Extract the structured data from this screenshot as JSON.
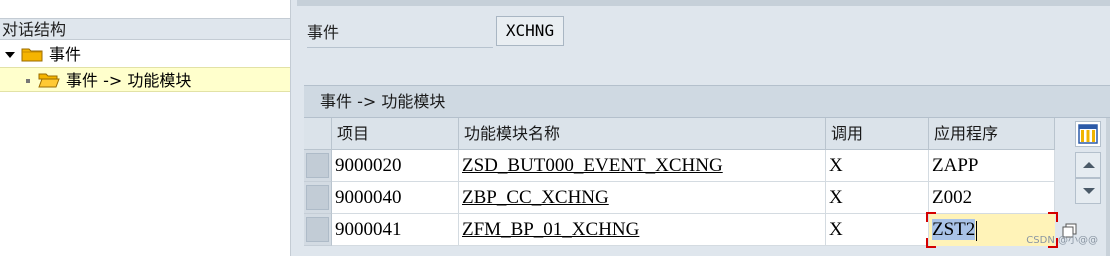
{
  "tree": {
    "header": "对话结构",
    "items": [
      {
        "label": "事件"
      },
      {
        "label": "事件 -> 功能模块"
      }
    ]
  },
  "form": {
    "event_label": "事件",
    "event_value": "XCHNG"
  },
  "table": {
    "title": "事件 -> 功能模块",
    "columns": [
      "项目",
      "功能模块名称",
      "调用",
      "应用程序"
    ],
    "rows": [
      {
        "item": "9000020",
        "function_module": "ZSD_BUT000_EVENT_XCHNG",
        "call": "X",
        "application": "ZAPP"
      },
      {
        "item": "9000040",
        "function_module": "ZBP_CC_XCHNG",
        "call": "X",
        "application": "Z002"
      },
      {
        "item": "9000041",
        "function_module": "ZFM_BP_01_XCHNG",
        "call": "X",
        "application": "ZST2"
      }
    ]
  },
  "watermark": "CSDN @小@@",
  "icons": {
    "expander": "triangle-down-icon",
    "folder": "folder-icon",
    "open_folder": "open-folder-icon",
    "table_settings": "table-settings-icon",
    "scroll_up": "arrow-up-icon",
    "scroll_down": "arrow-down-icon",
    "value_help": "value-help-icon"
  },
  "colors": {
    "background": "#dfe6ed",
    "selected_tree_row": "#ffffcc",
    "editing_cell": "#fff3b8",
    "focus_corner": "#d40000",
    "folder": "#f5b400"
  }
}
